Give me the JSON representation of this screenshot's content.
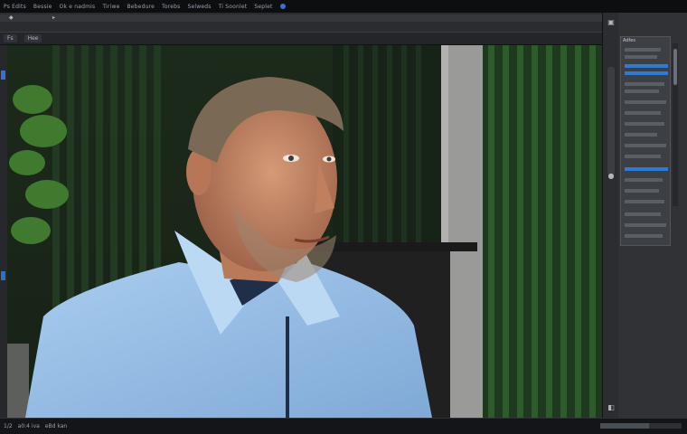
{
  "app": {
    "menu_items": [
      "Ps Edits",
      "Bessie",
      "Ok e nadmis",
      "Tiriwe",
      "Bebedure",
      "Torebs",
      "Selweds",
      "Ti Soonlet",
      "Seplet"
    ],
    "doc_tab_labels": [
      "Fs",
      "Hee"
    ],
    "status_items": [
      "1/2",
      "a0:4 iva",
      "eBd kan"
    ],
    "accent_color": "#2e7bd6"
  },
  "canvas": {
    "subject": "photo-man-blue-shirt",
    "shirt_color": "#9cc3ea",
    "background": "bamboo-fence"
  },
  "panel": {
    "title": "Adfes",
    "highlighted_rows": 2
  }
}
